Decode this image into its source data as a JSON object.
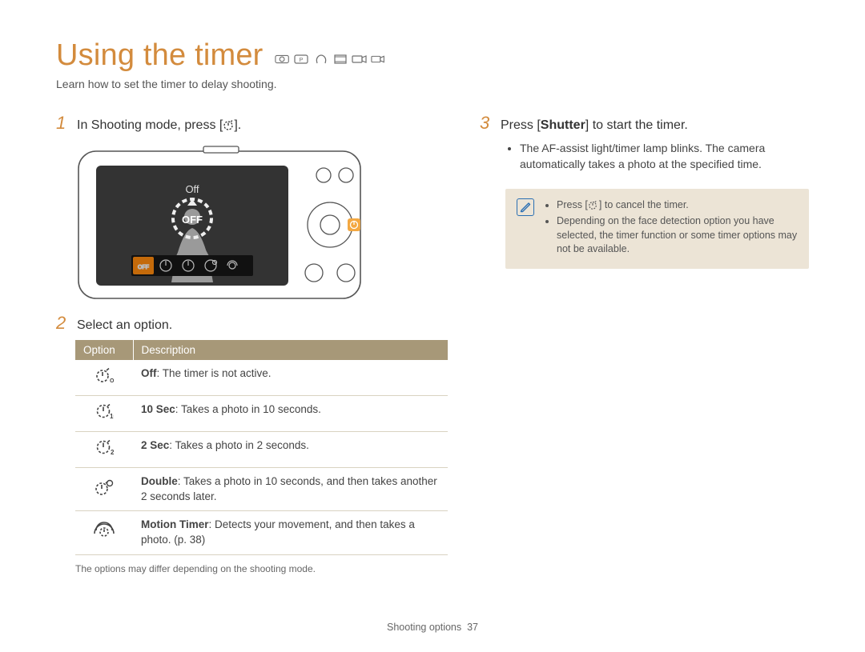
{
  "title": "Using the timer",
  "subtitle": "Learn how to set the timer to delay shooting.",
  "step1": {
    "num": "1",
    "prefix": "In Shooting mode, press [",
    "suffix": "]."
  },
  "step2": {
    "num": "2",
    "text": "Select an option."
  },
  "step3": {
    "num": "3",
    "prefix": "Press [",
    "bold": "Shutter",
    "suffix": "] to start the timer.",
    "bullet": "The AF-assist light/timer lamp blinks. The camera automatically takes a photo at the specified time."
  },
  "info": {
    "item1_prefix": "Press [",
    "item1_suffix": "] to cancel the timer.",
    "item2": "Depending on the face detection option you have selected, the timer function or some timer options may not be available."
  },
  "table": {
    "h_option": "Option",
    "h_desc": "Description",
    "rows": [
      {
        "icon": "off",
        "bold": "Off",
        "rest": ": The timer is not active."
      },
      {
        "icon": "t10",
        "bold": "10 Sec",
        "rest": ": Takes a photo in 10 seconds."
      },
      {
        "icon": "t2",
        "bold": "2 Sec",
        "rest": ": Takes a photo in 2 seconds."
      },
      {
        "icon": "double",
        "bold": "Double",
        "rest": ": Takes a photo in 10 seconds, and then takes another 2 seconds later."
      },
      {
        "icon": "motion",
        "bold": "Motion Timer",
        "rest": ": Detects your movement, and then takes a photo. (p. 38)"
      }
    ]
  },
  "footnote": "The options may differ depending on the shooting mode.",
  "footer_label": "Shooting options",
  "footer_page": "37",
  "camera_screen_label": "Off",
  "camera_off_badge": "OFF"
}
